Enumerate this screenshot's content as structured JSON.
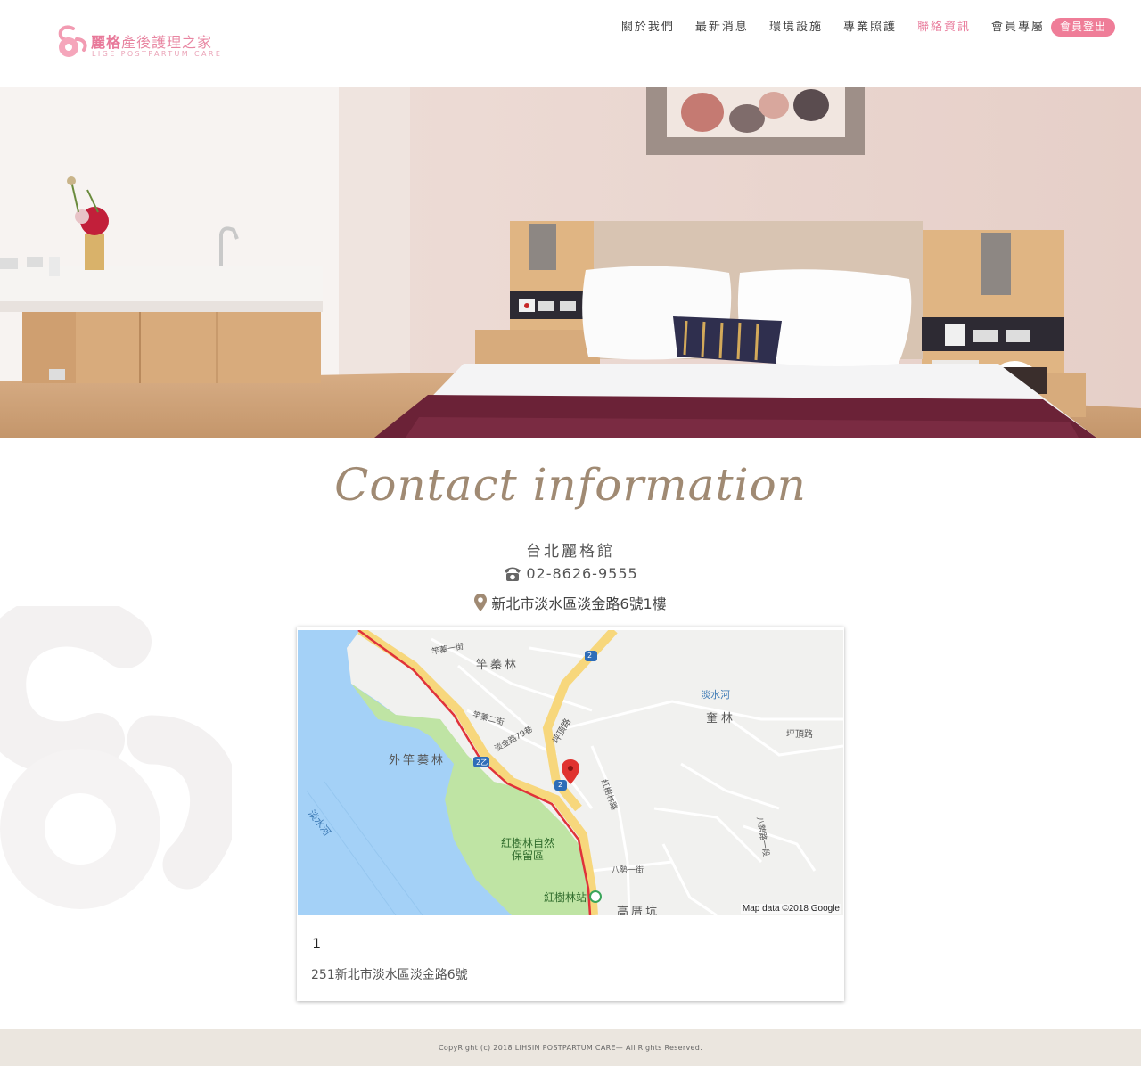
{
  "brand": {
    "name_cn_bold": "麗格",
    "name_cn_rest": "產後護理之家",
    "name_en": "LIGE POSTPARTUM CARE"
  },
  "nav": {
    "items": [
      {
        "label": "關於我們"
      },
      {
        "label": "最新消息"
      },
      {
        "label": "環境設施"
      },
      {
        "label": "專業照護"
      },
      {
        "label": "聯絡資訊"
      },
      {
        "label": "會員專屬"
      }
    ],
    "logout_label": "會員登出",
    "active_color": "#e8799a"
  },
  "contact": {
    "title": "Contact information",
    "branch_name": "台北麗格館",
    "phone": "02-8626-9555",
    "address": "新北市淡水區淡金路6號1樓"
  },
  "map": {
    "labels": {
      "area1": "竿蓁林",
      "area2": "外竿蓁林",
      "area3": "奎林",
      "river1": "淡水河",
      "river2": "淡水河",
      "reserve": "紅樹林自然保留區",
      "station": "紅樹林站",
      "area4": "高厝坑",
      "road1": "坪頂路",
      "road2": "坪頂路",
      "road3": "淡金路79巷",
      "road4": "紅樹林路",
      "road5": "竿蓁二街",
      "road6": "竿蓁一街",
      "road7": "八勢一街",
      "road8": "八勢路一段",
      "shield1": "2",
      "shield2": "2乙",
      "shield3": "2"
    },
    "credit": "Map data ©2018 Google"
  },
  "map_info": {
    "title": "1",
    "address": "251新北市淡水區淡金路6號"
  },
  "footer": {
    "copyright": "CopyRight (c) 2018   LIHSIN POSTPARTUM CARE— All Rights Reserved."
  },
  "icons": {
    "phone": "phone-icon",
    "location": "location-pin-icon",
    "marker": "map-marker-icon"
  },
  "colors": {
    "brand_pink": "#ef7d98",
    "title_gold": "#a08a73",
    "footer_bg": "#ebe6df",
    "water": "#a4d1f7",
    "park": "#bfe4a4"
  }
}
